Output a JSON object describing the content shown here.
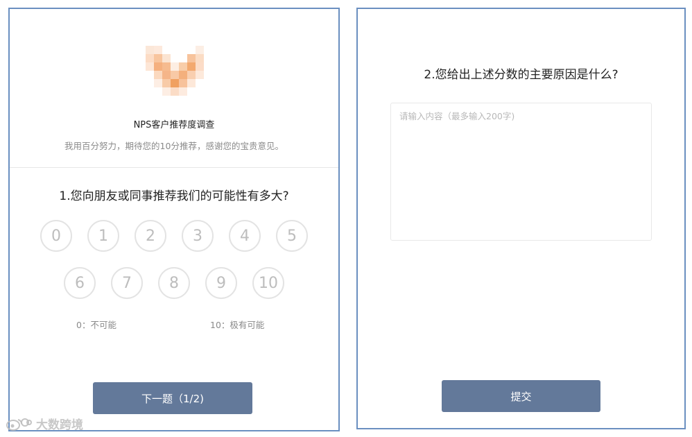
{
  "survey": {
    "title": "NPS客户推荐度调查",
    "description": "我用百分努力，期待您的10分推荐，感谢您的宝贵意见。"
  },
  "question1": {
    "title": "1.您向朋友或同事推荐我们的可能性有多大?",
    "scores_row1": [
      "0",
      "1",
      "2",
      "3",
      "4",
      "5"
    ],
    "scores_row2": [
      "6",
      "7",
      "8",
      "9",
      "10"
    ],
    "min_label": "0：不可能",
    "max_label": "10：极有可能",
    "next_label": "下一题（1/2)"
  },
  "question2": {
    "title": "2.您给出上述分数的主要原因是什么?",
    "placeholder": "请输入内容（最多输入200字)",
    "value": "",
    "submit_label": "提交"
  },
  "watermark": {
    "text": "大数跨境"
  },
  "colors": {
    "button": "#63799a",
    "panel_border": "#6a8fc0",
    "score_border": "#e3e3e3",
    "score_text": "#bdbdbd"
  },
  "icons": {
    "logo": "pixelated-logo",
    "watermark": "weibo-icon"
  }
}
